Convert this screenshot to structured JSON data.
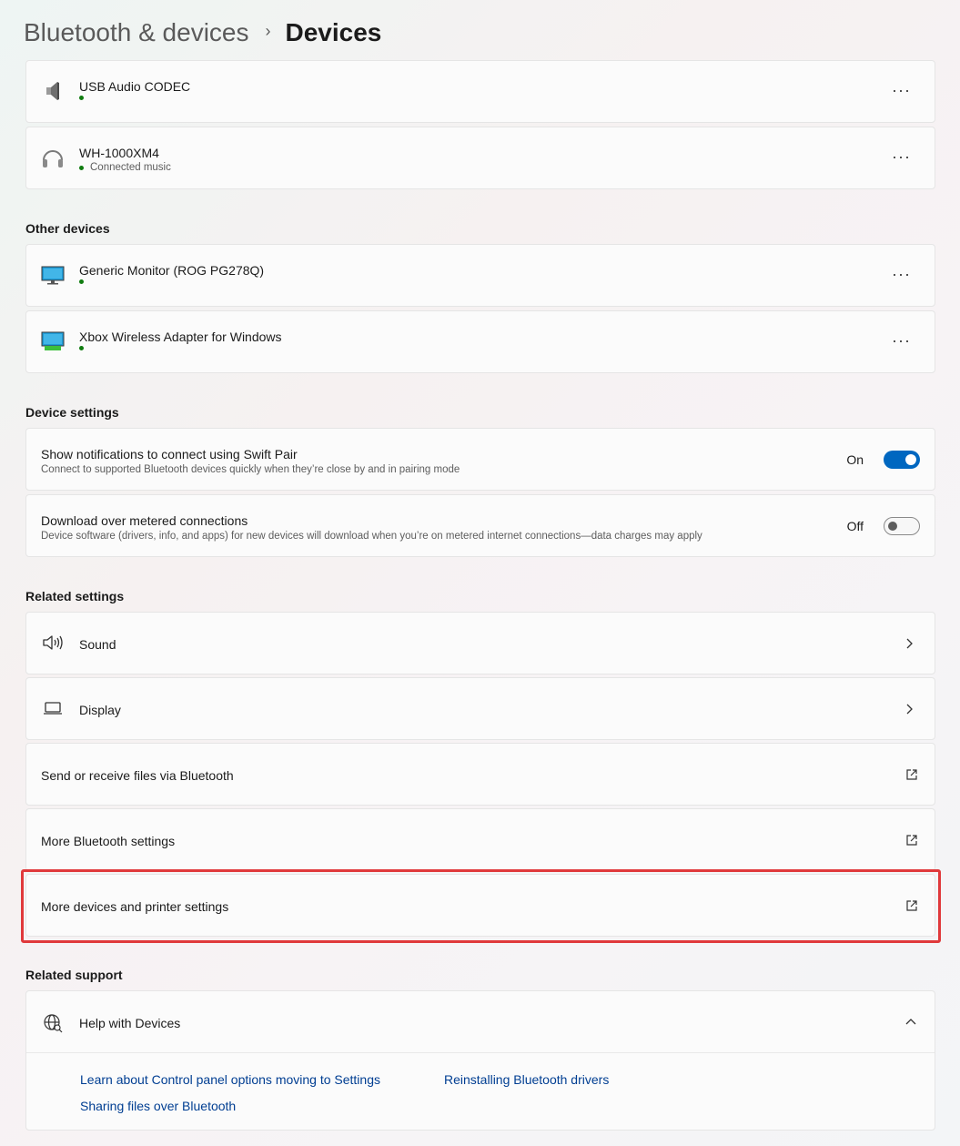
{
  "breadcrumb": {
    "parent": "Bluetooth & devices",
    "separator": "›",
    "current": "Devices"
  },
  "devices": [
    {
      "name": "USB Audio CODEC",
      "status": "",
      "icon": "speaker-icon"
    },
    {
      "name": "WH-1000XM4",
      "status": "Connected music",
      "icon": "headphones-icon"
    }
  ],
  "other_devices": {
    "title": "Other devices",
    "items": [
      {
        "name": "Generic Monitor (ROG PG278Q)",
        "status": "",
        "icon": "monitor-icon"
      },
      {
        "name": "Xbox Wireless Adapter for Windows",
        "status": "",
        "icon": "monitor-icon"
      }
    ]
  },
  "more_menu": "···",
  "device_settings": {
    "title": "Device settings",
    "swift_pair": {
      "title": "Show notifications to connect using Swift Pair",
      "desc": "Connect to supported Bluetooth devices quickly when they’re close by and in pairing mode",
      "state": "On",
      "on": true
    },
    "metered": {
      "title": "Download over metered connections",
      "desc": "Device software (drivers, info, and apps) for new devices will download when you’re on metered internet connections—data charges may apply",
      "state": "Off",
      "on": false
    }
  },
  "related_settings": {
    "title": "Related settings",
    "items": [
      {
        "label": "Sound",
        "icon": "sound-icon",
        "action": "chevron"
      },
      {
        "label": "Display",
        "icon": "display-icon",
        "action": "chevron"
      },
      {
        "label": "Send or receive files via Bluetooth",
        "icon": "",
        "action": "external"
      },
      {
        "label": "More Bluetooth settings",
        "icon": "",
        "action": "external"
      },
      {
        "label": "More devices and printer settings",
        "icon": "",
        "action": "external"
      }
    ]
  },
  "related_support": {
    "title": "Related support",
    "help": {
      "label": "Help with Devices",
      "icon": "globe-icon",
      "expanded": true
    },
    "links": [
      "Learn about Control panel options moving to Settings",
      "Reinstalling Bluetooth drivers",
      "Sharing files over Bluetooth"
    ]
  },
  "colors": {
    "accent": "#0067c0",
    "status_green": "#107c10",
    "highlight": "#e0393b",
    "link": "#003e92"
  }
}
